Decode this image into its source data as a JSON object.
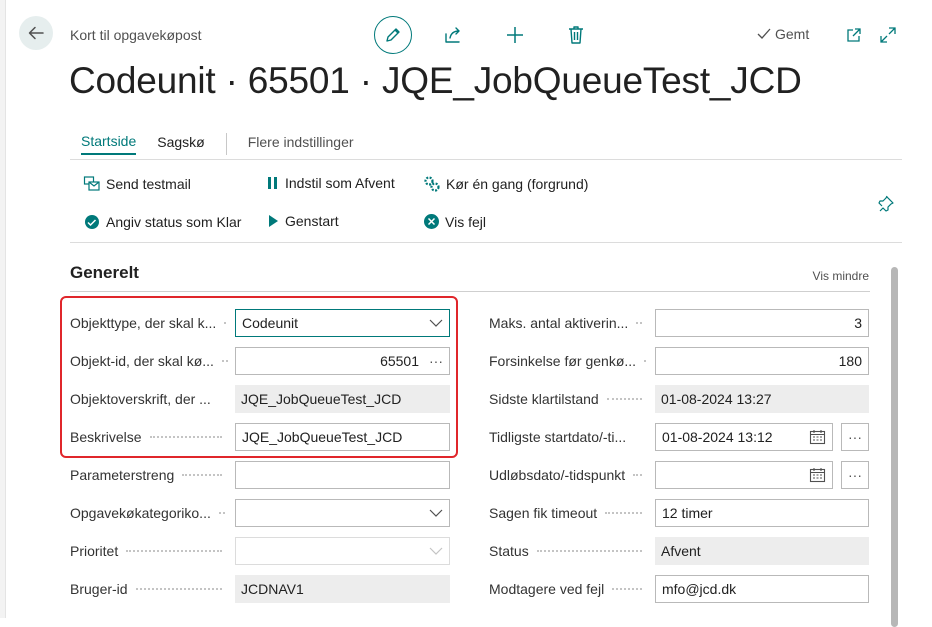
{
  "header": {
    "caption": "Kort til opgavekøpost",
    "saved_label": "Gemt",
    "title": "Codeunit · 65501 · JQE_JobQueueTest_JCD",
    "icons": [
      "back-arrow-icon",
      "pencil-icon",
      "share-icon",
      "plus-icon",
      "trash-icon",
      "checkmark-icon",
      "open-new-window-icon",
      "expand-icon"
    ]
  },
  "tabs": [
    {
      "label": "Startside",
      "active": true
    },
    {
      "label": "Sagskø",
      "active": false
    },
    {
      "label": "Flere indstillinger",
      "active": false
    }
  ],
  "actions": {
    "send_testmail": "Send testmail",
    "set_on_hold": "Indstil som Afvent",
    "run_once": "Kør én gang (forgrund)",
    "set_ready": "Angiv status som Klar",
    "restart": "Genstart",
    "show_error": "Vis fejl"
  },
  "section": {
    "title": "Generelt",
    "toggle_label": "Vis mindre"
  },
  "left_fields": [
    {
      "label": "Objekttype, der skal k...",
      "value": "Codeunit"
    },
    {
      "label": "Objekt-id, der skal kø...",
      "value": "65501"
    },
    {
      "label": "Objektoverskrift, der ...",
      "value": "JQE_JobQueueTest_JCD"
    },
    {
      "label": "Beskrivelse",
      "value": "JQE_JobQueueTest_JCD"
    },
    {
      "label": "Parameterstreng",
      "value": ""
    },
    {
      "label": "Opgavekøkategoriko...",
      "value": ""
    },
    {
      "label": "Prioritet",
      "value": ""
    },
    {
      "label": "Bruger-id",
      "value": "JCDNAV1"
    }
  ],
  "right_fields": [
    {
      "label": "Maks. antal aktiverin...",
      "value": "3"
    },
    {
      "label": "Forsinkelse før genkø...",
      "value": "180"
    },
    {
      "label": "Sidste klartilstand",
      "value": "01-08-2024 13:27"
    },
    {
      "label": "Tidligste startdato/-ti...",
      "value": "01-08-2024 13:12"
    },
    {
      "label": "Udløbsdato/-tidspunkt",
      "value": ""
    },
    {
      "label": "Sagen fik timeout",
      "value": "12 timer"
    },
    {
      "label": "Status",
      "value": "Afvent"
    },
    {
      "label": "Modtagere ved fejl",
      "value": "mfo@jcd.dk"
    }
  ],
  "colors": {
    "accent": "#00797a",
    "highlight": "#e0262b",
    "readonly_bg": "#ededed"
  },
  "ellipsis_glyph": "···"
}
